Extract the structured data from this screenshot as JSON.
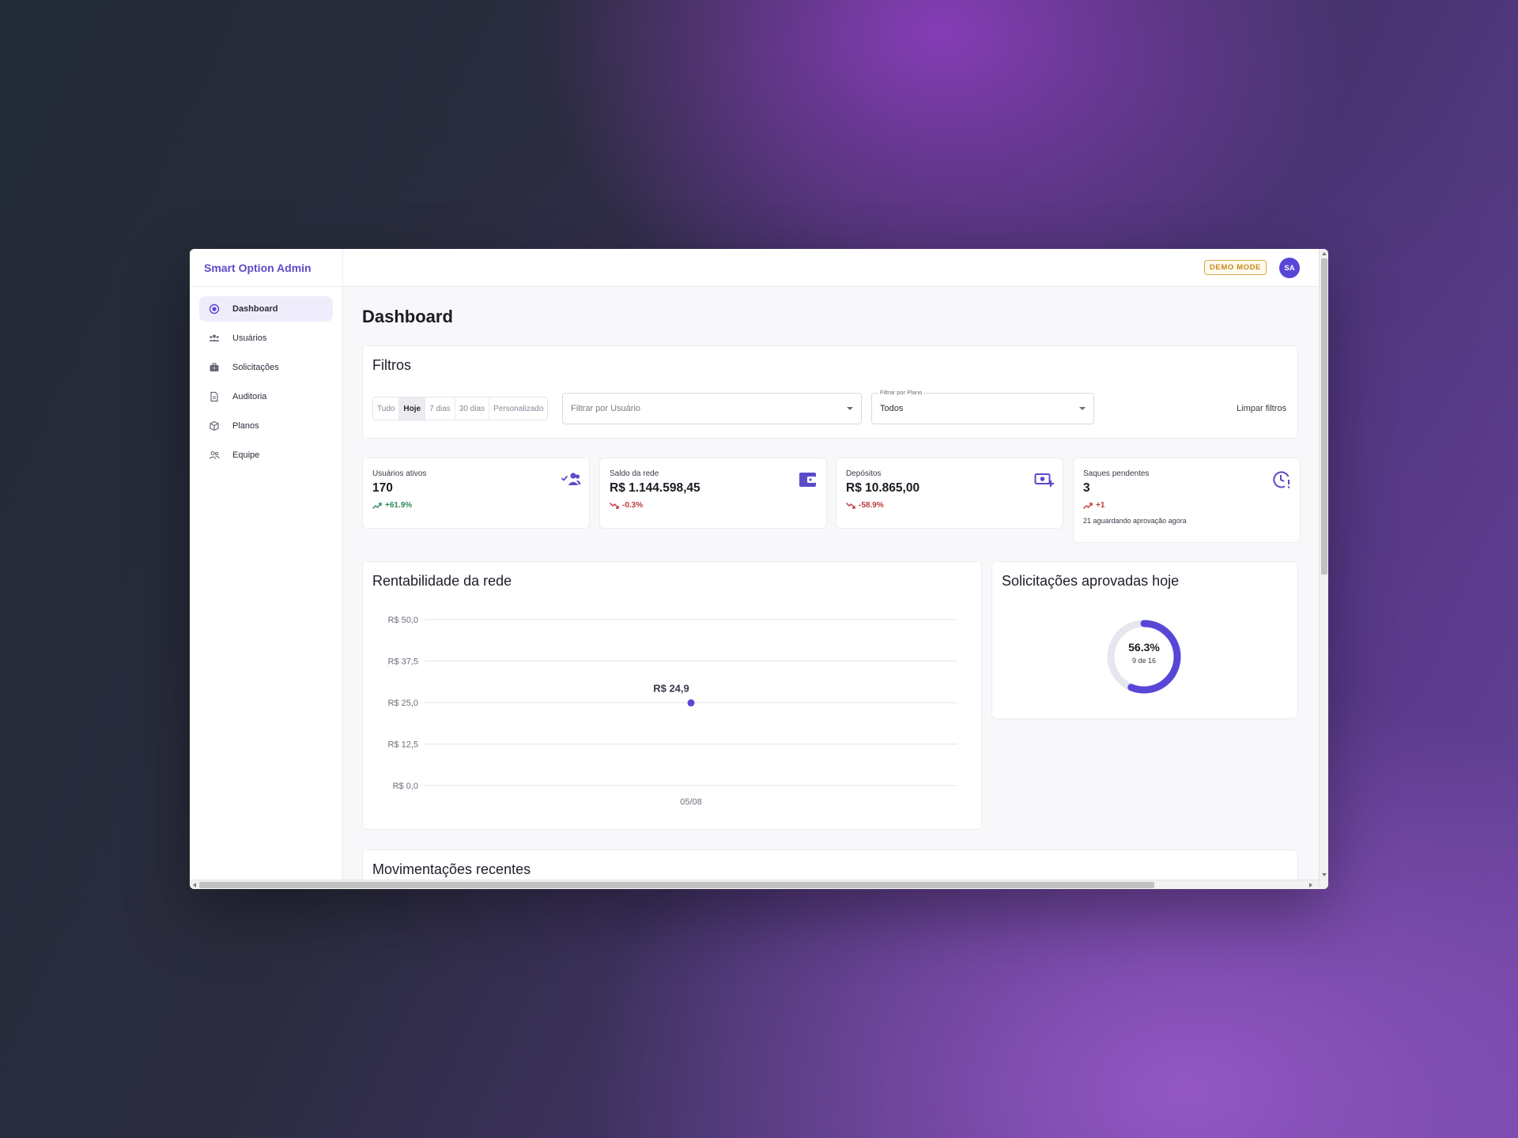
{
  "app": {
    "brand": "Smart Option Admin"
  },
  "sidebar": {
    "items": [
      {
        "label": "Dashboard",
        "icon": "dashboard-icon",
        "active": true
      },
      {
        "label": "Usuários",
        "icon": "users-icon"
      },
      {
        "label": "Solicitações",
        "icon": "briefcase-icon"
      },
      {
        "label": "Auditoria",
        "icon": "document-icon"
      },
      {
        "label": "Planos",
        "icon": "box-icon"
      },
      {
        "label": "Equipe",
        "icon": "team-icon"
      }
    ]
  },
  "topbar": {
    "badge": "DEMO MODE",
    "avatar_initials": "SA"
  },
  "page": {
    "title": "Dashboard"
  },
  "filters": {
    "title": "Filtros",
    "periods": [
      "Tudo",
      "Hoje",
      "7 dias",
      "30 dias",
      "Personalizado"
    ],
    "active_period": "Hoje",
    "user_select": {
      "placeholder": "Filtrar por Usuário"
    },
    "plan_select": {
      "label": "Filtrar por Plano",
      "value": "Todos"
    },
    "clear_label": "Limpar filtros"
  },
  "stats": [
    {
      "label": "Usuários ativos",
      "value": "170",
      "delta": "+61.9%",
      "trend": "up",
      "icon": "users-check-icon"
    },
    {
      "label": "Saldo da rede",
      "value": "R$ 1.144.598,45",
      "delta": "-0.3%",
      "trend": "down",
      "icon": "wallet-icon"
    },
    {
      "label": "Depósitos",
      "value": "R$ 10.865,00",
      "delta": "-58.9%",
      "trend": "down",
      "icon": "cash-plus-icon"
    },
    {
      "label": "Saques pendentes",
      "value": "3",
      "delta": "+1",
      "trend": "up-red",
      "icon": "clock-alert-icon",
      "note": "21 aguardando aprovação agora"
    }
  ],
  "line_chart": {
    "title": "Rentabilidade da rede",
    "y_ticks": [
      "R$ 50,0",
      "R$ 37,5",
      "R$ 25,0",
      "R$ 12,5",
      "R$ 0,0"
    ],
    "point_label": "R$ 24,9",
    "x_label": "05/08"
  },
  "donut": {
    "title": "Solicitações aprovadas hoje",
    "percent_label": "56.3%",
    "sub_label": "9 de 16",
    "fraction": 0.5625,
    "color": "#5847d6",
    "track_color": "#e6e6ee"
  },
  "recent": {
    "title": "Movimentações recentes"
  },
  "colors": {
    "accent": "#5847d6",
    "brand": "#5b4bc8",
    "up": "#2f8a5c",
    "down": "#c0393b",
    "badge": "#c78a17"
  },
  "chart_data": {
    "type": "line",
    "title": "Rentabilidade da rede",
    "x": [
      "05/08"
    ],
    "series": [
      {
        "values": [
          24.9
        ]
      }
    ],
    "ylim": [
      0,
      50
    ],
    "y_ticks": [
      0,
      12.5,
      25,
      37.5,
      50
    ],
    "grid": true
  }
}
